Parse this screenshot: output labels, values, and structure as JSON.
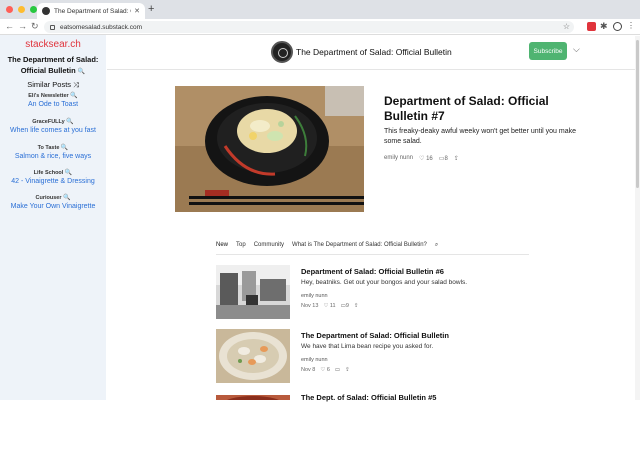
{
  "browser": {
    "tab_title": "The Department of Salad: Offic",
    "url": "eatsomesalad.substack.com"
  },
  "sidebar": {
    "brand": "stacksear.ch",
    "pub_title_line1": "The Department of Salad:",
    "pub_title_line2": "Official Bulletin",
    "similar": "Similar Posts",
    "groups": [
      {
        "label": "Eli's Newsletter",
        "link": "An Ode to Toast"
      },
      {
        "label": "GraceFULLy",
        "link": "When life comes at you fast"
      },
      {
        "label": "To Taste",
        "link": "Salmon & rice, five ways"
      },
      {
        "label": "Life School",
        "link": "42 - Vinaigrette & Dressing"
      },
      {
        "label": "Curiouser",
        "link": "Make Your Own Vinaigrette"
      }
    ]
  },
  "header": {
    "pub_name": "The Department of Salad: Official Bulletin",
    "subscribe": "Subscribe"
  },
  "hero": {
    "title": "Department of Salad: Official Bulletin #7",
    "subtitle": "This freaky-deaky awful weeky won't get better until you make some salad.",
    "author": "emily nunn",
    "likes": "16",
    "comments": "8"
  },
  "tabs": [
    "New",
    "Top",
    "Community",
    "What is The Department of Salad: Official Bulletin?"
  ],
  "posts": [
    {
      "title": "Department of Salad: Official Bulletin #6",
      "desc": "Hey, beatniks. Get out your bongos and your salad bowls.",
      "author": "emily nunn",
      "date": "Nov 13",
      "likes": "11",
      "comments": "9"
    },
    {
      "title": "The Department of Salad: Official Bulletin",
      "desc": "We have that Lima bean recipe you asked for.",
      "author": "emily nunn",
      "date": "Nov 8",
      "likes": "6",
      "comments": ""
    },
    {
      "title": "The Dept. of Salad: Official Bulletin #5",
      "desc": "",
      "author": "",
      "date": "",
      "likes": "",
      "comments": ""
    }
  ]
}
